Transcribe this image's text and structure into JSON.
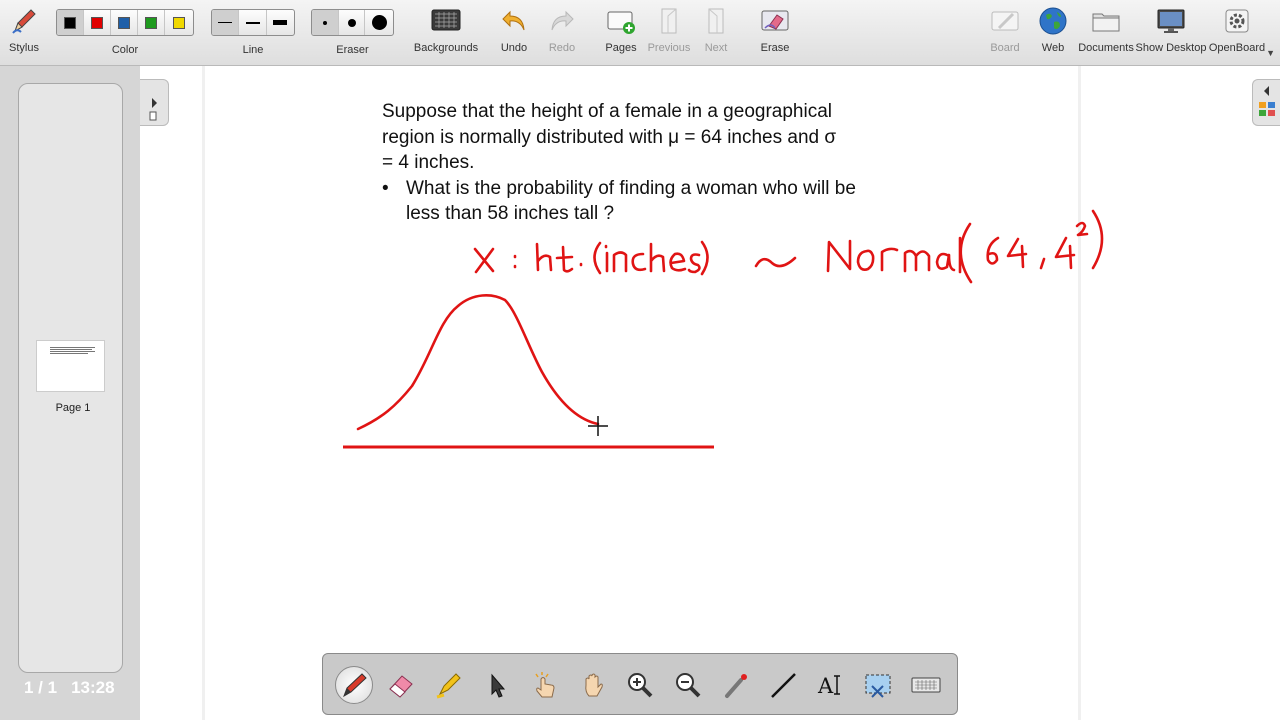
{
  "toolbar": {
    "stylus": "Stylus",
    "color": "Color",
    "line": "Line",
    "eraser": "Eraser",
    "backgrounds": "Backgrounds",
    "undo": "Undo",
    "redo": "Redo",
    "pages": "Pages",
    "previous": "Previous",
    "next": "Next",
    "erase": "Erase",
    "board": "Board",
    "web": "Web",
    "documents": "Documents",
    "show_desktop": "Show Desktop",
    "openboard": "OpenBoard"
  },
  "palette_colors": [
    "#000000",
    "#e00000",
    "#1f5fa8",
    "#1e9a1e",
    "#f0d800"
  ],
  "selected_color": "#000000",
  "ink_color": "#e01414",
  "pages_pane": {
    "thumbnail_label": "Page 1",
    "page_counter": "1 / 1",
    "clock": "13:28"
  },
  "board": {
    "question_line1": "Suppose that the height of a female in a geographical",
    "question_line2": "region is normally distributed with  μ = 64 inches and σ",
    "question_line3": "= 4 inches.",
    "bullet": "•",
    "question_bullet1": "What is the probability of finding a woman who will be",
    "question_bullet2": "less than 58 inches tall ?",
    "handwritten": "X : ht·(inches) ~ Normal (64, 4²)"
  },
  "stylus_palette": [
    "pen-tool",
    "eraser-tool",
    "highlighter-tool",
    "selector-tool",
    "interact-tool",
    "hand-tool",
    "zoom-in-tool",
    "zoom-out-tool",
    "laser-pointer-tool",
    "line-tool",
    "text-tool",
    "capture-tool",
    "keyboard-tool"
  ]
}
